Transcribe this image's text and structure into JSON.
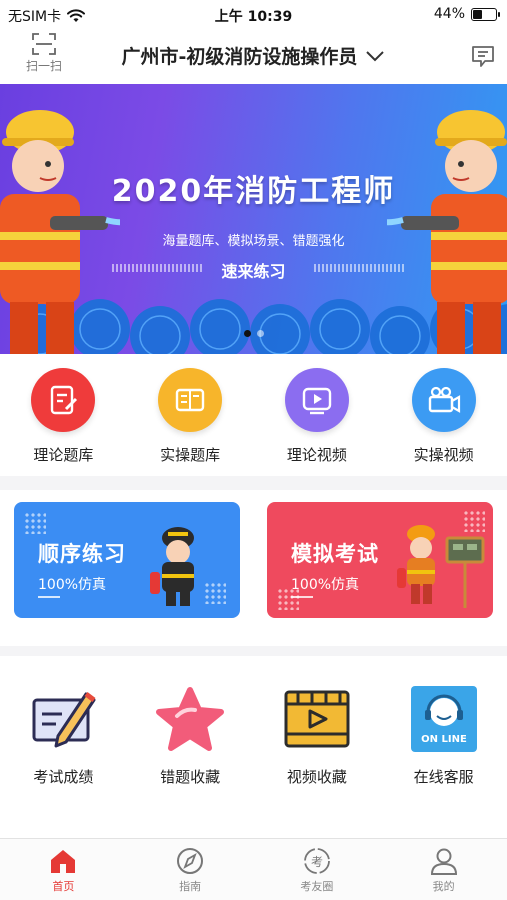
{
  "status_bar": {
    "carrier": "无SIM卡",
    "time": "上午 10:39",
    "battery_text": "44%",
    "battery_level": 0.44
  },
  "header": {
    "scan_label": "扫一扫",
    "title": "广州市-初级消防设施操作员",
    "dropdown_icon": "chevron-down-icon",
    "message_icon": "message-icon"
  },
  "banner": {
    "headline": "2020年消防工程师",
    "subtitle": "海量题库、模拟场景、错题强化",
    "cta": "速来练习",
    "page_count": 2,
    "active_page": 0
  },
  "quick_row": [
    {
      "label": "理论题库",
      "icon": "edit-note-icon",
      "color": "#ef3b3b"
    },
    {
      "label": "实操题库",
      "icon": "book-icon",
      "color": "#f7b52b"
    },
    {
      "label": "理论视频",
      "icon": "play-video-icon",
      "color": "#8b6df0"
    },
    {
      "label": "实操视频",
      "icon": "video-camera-icon",
      "color": "#3c9bf3"
    }
  ],
  "cards": [
    {
      "title": "顺序练习",
      "subtitle": "100%仿真",
      "color": "#3b8df3"
    },
    {
      "title": "模拟考试",
      "subtitle": "100%仿真",
      "color": "#ef4a5e"
    }
  ],
  "feature_row": [
    {
      "label": "考试成绩",
      "icon": "exam-score-icon"
    },
    {
      "label": "错题收藏",
      "icon": "star-icon"
    },
    {
      "label": "视频收藏",
      "icon": "video-collect-icon"
    },
    {
      "label": "在线客服",
      "icon": "online-service-icon",
      "badge": "ON LINE"
    }
  ],
  "tabbar": [
    {
      "label": "首页",
      "icon": "home-icon",
      "active": true
    },
    {
      "label": "指南",
      "icon": "compass-icon",
      "active": false
    },
    {
      "label": "考友圈",
      "icon": "circle-icon",
      "badge": "考",
      "active": false
    },
    {
      "label": "我的",
      "icon": "user-icon",
      "active": false
    }
  ],
  "colors": {
    "accent": "#e53935",
    "banner_start": "#6a3fe0",
    "banner_end": "#2f9cf3"
  }
}
